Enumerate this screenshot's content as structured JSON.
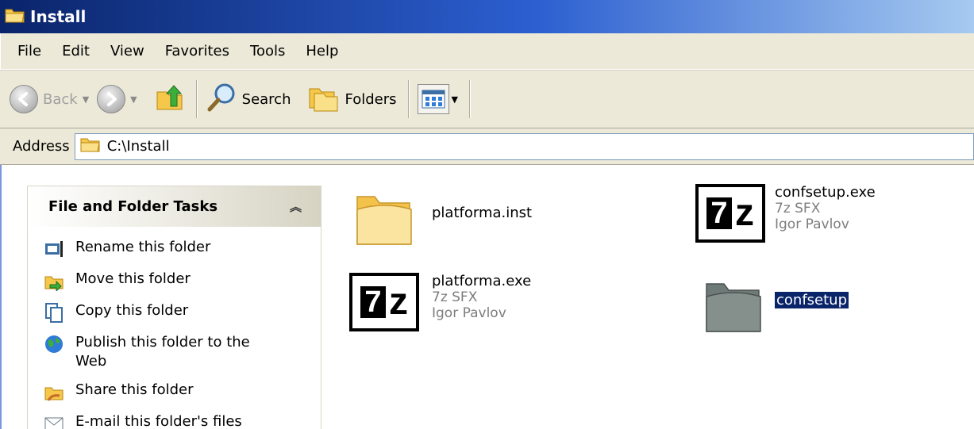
{
  "window": {
    "title": "Install"
  },
  "menu": {
    "items": [
      "File",
      "Edit",
      "View",
      "Favorites",
      "Tools",
      "Help"
    ]
  },
  "toolbar": {
    "back_label": "Back",
    "search_label": "Search",
    "folders_label": "Folders"
  },
  "address": {
    "label": "Address",
    "value": "C:\\Install"
  },
  "tasks": {
    "title": "File and Folder Tasks",
    "items": [
      {
        "label": "Rename this folder",
        "icon": "rename-icon"
      },
      {
        "label": "Move this folder",
        "icon": "move-icon"
      },
      {
        "label": "Copy this folder",
        "icon": "copy-icon"
      },
      {
        "label": "Publish this folder to the Web",
        "icon": "publish-web-icon"
      },
      {
        "label": "Share this folder",
        "icon": "share-icon"
      },
      {
        "label": "E-mail this folder's files",
        "icon": "email-icon"
      }
    ]
  },
  "files": [
    {
      "name": "platforma.inst",
      "type": "folder"
    },
    {
      "name": "confsetup.exe",
      "line2": "7z SFX",
      "line3": "Igor Pavlov",
      "type": "exe"
    },
    {
      "name": "platforma.exe",
      "line2": "7z SFX",
      "line3": "Igor Pavlov",
      "type": "exe"
    },
    {
      "name": "confsetup",
      "type": "folder",
      "selected": true
    }
  ],
  "colors": {
    "titlebar": "#0a246a",
    "chrome": "#ece9d8",
    "selection": "#0a246a"
  }
}
